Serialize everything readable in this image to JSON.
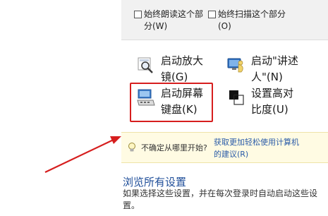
{
  "options": {
    "always_read": "始终朗读这个部\n分(W)",
    "always_scan": "始终扫描这个部分\n(O)"
  },
  "tools": {
    "magnifier": "启动放大\n镜(G)",
    "narrator": "启动\"讲述\n人\"(N)",
    "osk": "启动屏幕\n键盘(K)",
    "contrast": "设置高对\n比度(U)"
  },
  "tip": {
    "prompt": "不确定从哪里开始?",
    "link": "获取更加轻松使用计算机\n的建议(R)"
  },
  "browse": {
    "title": "浏览所有设置",
    "description": "如果选择这些设置，并在每次登录时自动启动这些设\n置。"
  },
  "colors": {
    "highlight": "#d61e1e",
    "link": "#2a5ba8",
    "tip_background": "#fffbe3"
  },
  "icons": [
    "magnifier-icon",
    "narrator-icon",
    "keyboard-icon",
    "contrast-icon",
    "lightbulb-icon"
  ]
}
